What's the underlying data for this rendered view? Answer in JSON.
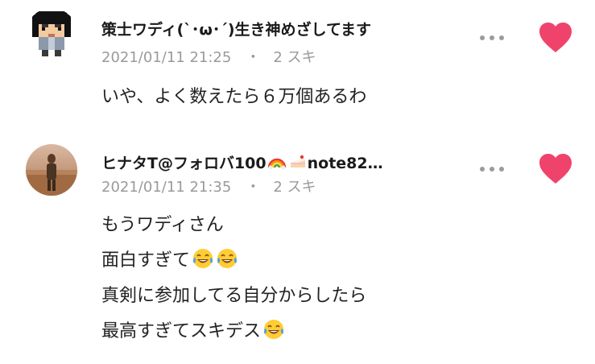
{
  "comments": [
    {
      "author": "策士ワディ(`･ω･´)生き神めざしてます",
      "date": "2021/01/11 21:25",
      "separator": "・",
      "likes": "2 スキ",
      "avatar": "pixel-character-avatar",
      "liked": true,
      "body": "いや、よく数えたら６万個あるわ"
    },
    {
      "author": "ヒナタT@フォロバ100",
      "author_emojis": [
        "rainbow-emoji",
        "cake-emoji"
      ],
      "author_suffix": "note82…",
      "date": "2021/01/11 21:35",
      "separator": "・",
      "likes": "2 スキ",
      "avatar": "photo-avatar",
      "liked": true,
      "body_lines": [
        {
          "text": "もうワディさん",
          "emojis": []
        },
        {
          "text": "面白すぎて",
          "emojis": [
            "tears-of-joy-emoji",
            "tears-of-joy-emoji"
          ]
        },
        {
          "text": "真剣に参加してる自分からしたら",
          "emojis": []
        },
        {
          "text": "最高すぎてスキデス",
          "emojis": [
            "tears-of-joy-emoji"
          ]
        }
      ]
    }
  ],
  "colors": {
    "heart": "#f0436b",
    "meta_text": "#9a9a9a",
    "more_dots": "#9b9b9b",
    "body_text": "#222222"
  }
}
